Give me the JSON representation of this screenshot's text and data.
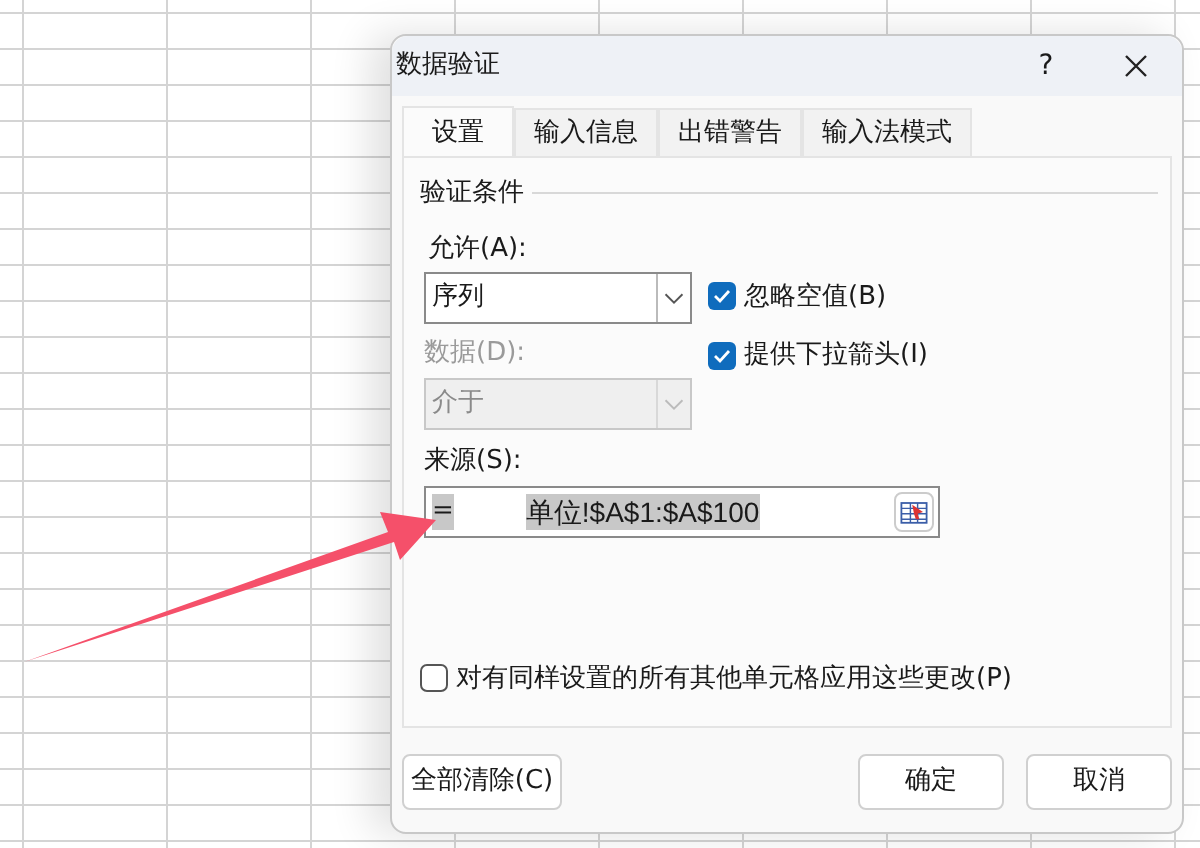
{
  "window": {
    "title": "数据验证",
    "help": "?"
  },
  "tabs": [
    {
      "label": "设置",
      "selected": true
    },
    {
      "label": "输入信息",
      "selected": false
    },
    {
      "label": "出错警告",
      "selected": false
    },
    {
      "label": "输入法模式",
      "selected": false
    }
  ],
  "group_title": "验证条件",
  "allow": {
    "label": "允许(A):",
    "value": "序列",
    "disabled": false
  },
  "data": {
    "label": "数据(D):",
    "value": "介于",
    "disabled": true
  },
  "options": [
    {
      "label": "忽略空值(B)",
      "checked": true
    },
    {
      "label": "提供下拉箭头(I)",
      "checked": true
    }
  ],
  "source": {
    "label": "来源(S):",
    "value": [
      "=",
      "单位!$A$1:$A$100"
    ]
  },
  "apply_all": {
    "label": "对有同样设置的所有其他单元格应用这些更改(P)",
    "checked": false
  },
  "buttons": [
    {
      "label": "全部清除(C)",
      "kind": "clear"
    },
    {
      "label": "确定",
      "kind": "default"
    },
    {
      "label": "取消",
      "kind": "normal"
    }
  ]
}
